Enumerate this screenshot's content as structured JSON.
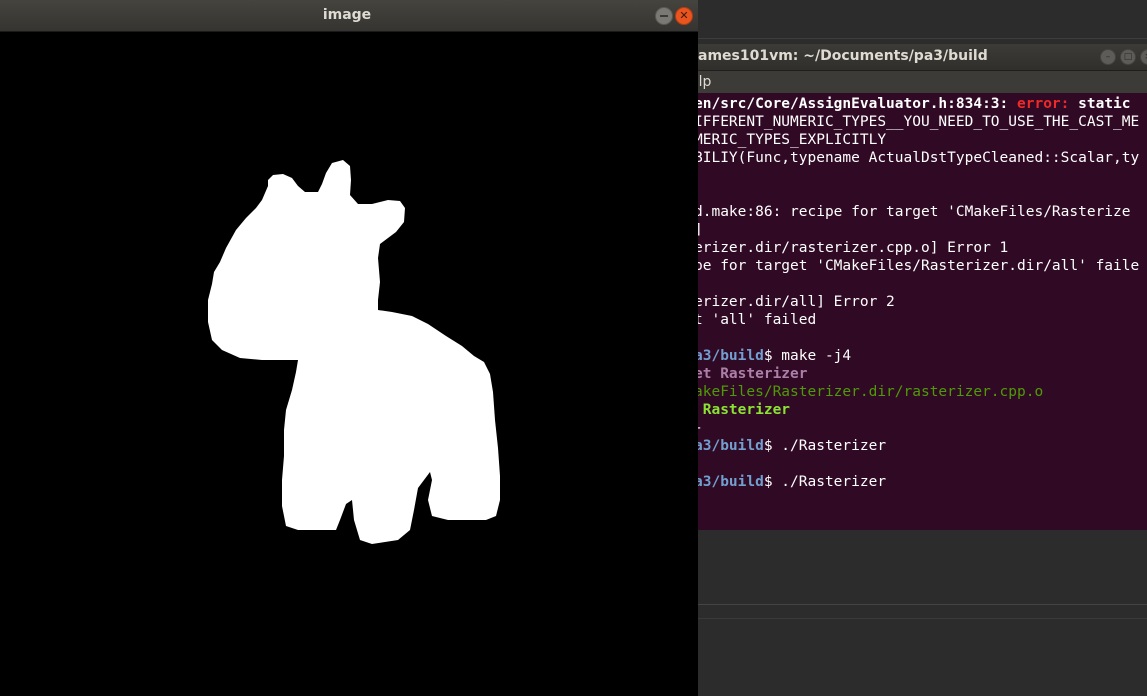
{
  "image_window": {
    "title": "image",
    "close_glyph": "✕",
    "silhouette_color": "#ffffff",
    "background_color": "#000000"
  },
  "terminal": {
    "title": "ames101vm: ~/Documents/pa3/build",
    "menu_label": "elp",
    "lines": [
      {
        "segments": [
          {
            "text": "en/src/Core/AssignEvaluator.h:834:3: ",
            "cls": "t-bold"
          },
          {
            "text": "error:",
            "cls": "c-error"
          },
          {
            "text": " static",
            "cls": "t-bold"
          }
        ]
      },
      {
        "segments": [
          {
            "text": "IFFERENT_NUMERIC_TYPES__YOU_NEED_TO_USE_THE_CAST_ME",
            "cls": ""
          }
        ]
      },
      {
        "segments": [
          {
            "text": "MERIC_TYPES_EXPLICITLY",
            "cls": ""
          }
        ]
      },
      {
        "segments": [
          {
            "text": "BILIY(Func,typename ActualDstTypeCleaned::Scalar,ty",
            "cls": ""
          }
        ]
      },
      {
        "segments": [
          {
            "text": "",
            "cls": ""
          }
        ]
      },
      {
        "segments": [
          {
            "text": "",
            "cls": ""
          }
        ]
      },
      {
        "segments": [
          {
            "text": "d.make:86: recipe for target 'CMakeFiles/Rasterize",
            "cls": ""
          }
        ]
      },
      {
        "segments": [
          {
            "text": "]",
            "cls": ""
          }
        ]
      },
      {
        "segments": [
          {
            "text": "erizer.dir/rasterizer.cpp.o] Error 1",
            "cls": ""
          }
        ]
      },
      {
        "segments": [
          {
            "text": "pe for target 'CMakeFiles/Rasterizer.dir/all' faile",
            "cls": ""
          }
        ]
      },
      {
        "segments": [
          {
            "text": "",
            "cls": ""
          }
        ]
      },
      {
        "segments": [
          {
            "text": "erizer.dir/all] Error 2",
            "cls": ""
          }
        ]
      },
      {
        "segments": [
          {
            "text": "t 'all' failed",
            "cls": ""
          }
        ]
      },
      {
        "segments": [
          {
            "text": "",
            "cls": ""
          }
        ]
      },
      {
        "segments": [
          {
            "text": "a3/build",
            "cls": "c-blue"
          },
          {
            "text": "$ make -j4",
            "cls": ""
          }
        ]
      },
      {
        "segments": [
          {
            "text": "et Rasterizer",
            "cls": "c-magenta"
          }
        ]
      },
      {
        "segments": [
          {
            "text": "akeFiles/Rasterizer.dir/rasterizer.cpp.o",
            "cls": "c-green"
          }
        ]
      },
      {
        "segments": [
          {
            "text": " Rasterizer",
            "cls": "c-greenb"
          }
        ]
      },
      {
        "segments": [
          {
            "text": "-",
            "cls": ""
          }
        ]
      },
      {
        "segments": [
          {
            "text": "a3/build",
            "cls": "c-blue"
          },
          {
            "text": "$ ./Rasterizer",
            "cls": ""
          }
        ]
      },
      {
        "segments": [
          {
            "text": "",
            "cls": ""
          }
        ]
      },
      {
        "segments": [
          {
            "text": "a3/build",
            "cls": "c-blue"
          },
          {
            "text": "$ ./Rasterizer",
            "cls": ""
          }
        ]
      }
    ]
  }
}
